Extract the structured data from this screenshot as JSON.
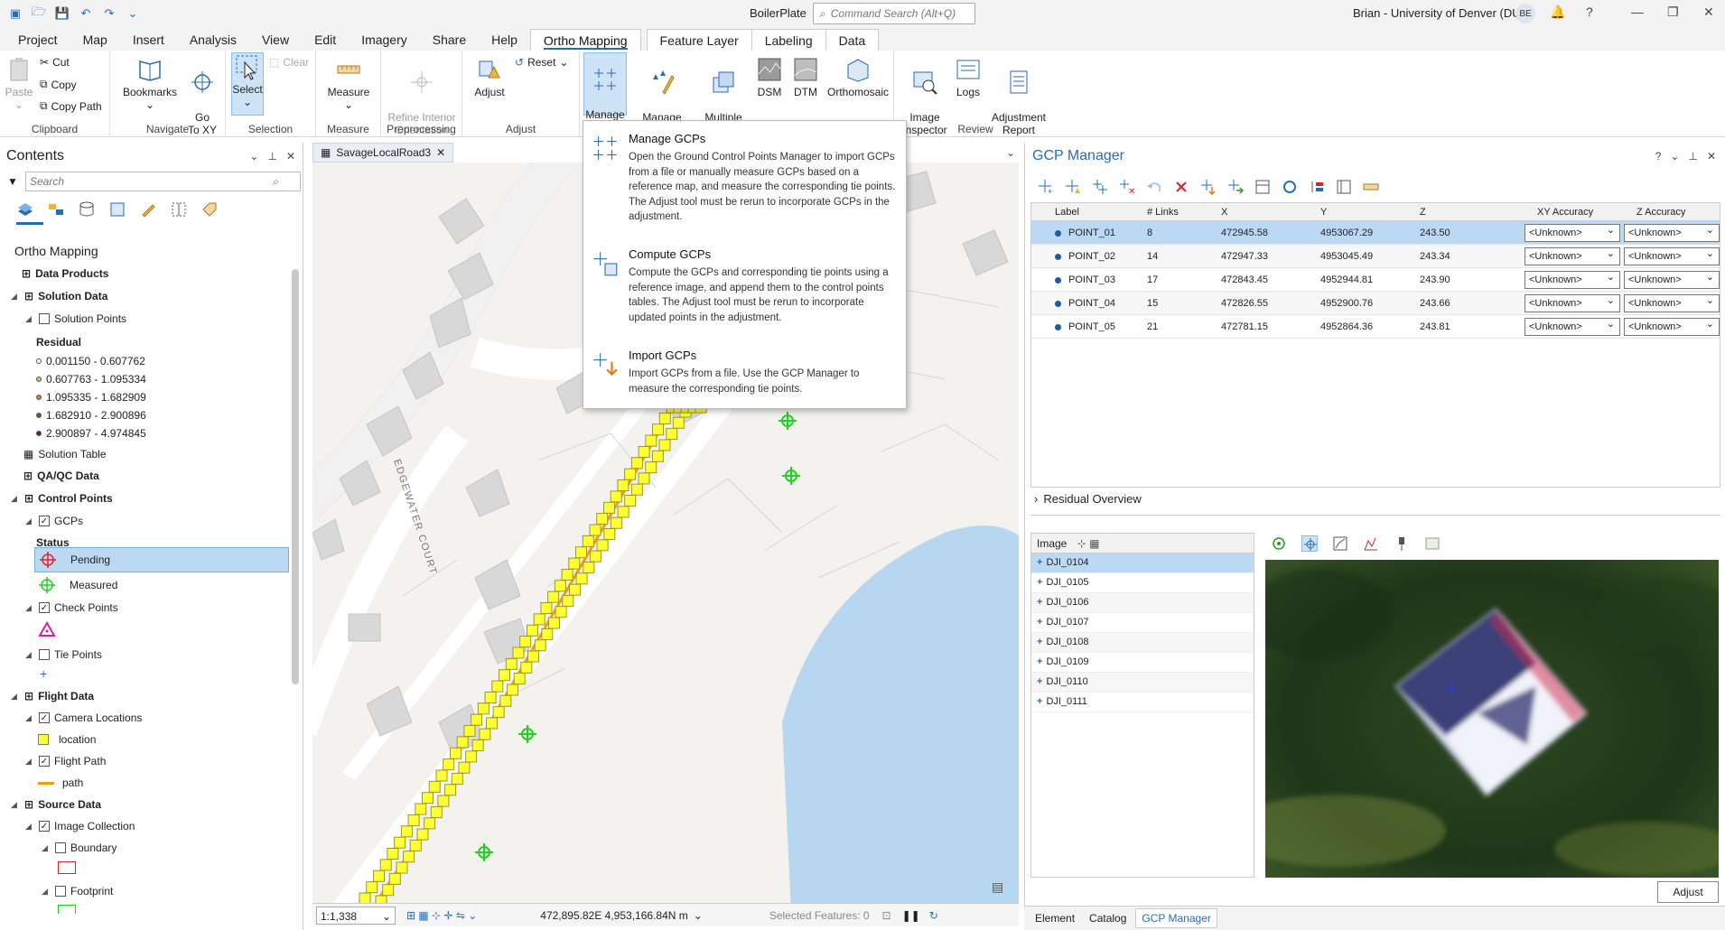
{
  "titlebar": {
    "project_name": "BoilerPlate",
    "command_search_placeholder": "Command Search (Alt+Q)",
    "user": "Brian - University of Denver (DU)",
    "avatar_initials": "BE"
  },
  "ribbon_tabs": [
    "Project",
    "Map",
    "Insert",
    "Analysis",
    "View",
    "Edit",
    "Imagery",
    "Share",
    "Help",
    "Ortho Mapping",
    "Feature Layer",
    "Labeling",
    "Data"
  ],
  "ribbon": {
    "clipboard": {
      "paste": "Paste",
      "cut": "Cut",
      "copy": "Copy",
      "copy_path": "Copy Path",
      "label": "Clipboard"
    },
    "navigate": {
      "bookmarks": "Bookmarks",
      "goto": "Go\nTo XY",
      "label": "Navigate"
    },
    "selection": {
      "select": "Select",
      "clear": "Clear",
      "label": "Selection"
    },
    "measure": {
      "measure": "Measure",
      "label": "Measure"
    },
    "preprocessing": {
      "refine": "Refine Interior\nOrientation",
      "label": "Preprocessing"
    },
    "adjust": {
      "adjust": "Adjust",
      "reset": "Reset",
      "label": "Adjust"
    },
    "gcps": {
      "manage_gcps": "Manage\nGCPs",
      "manage_tie": "Manage\nTie Points"
    },
    "products": {
      "multiple": "Multiple\nProducts",
      "dsm": "DSM",
      "dtm": "DTM",
      "ortho": "Orthomosaic"
    },
    "review": {
      "inspector": "Image\nInspector",
      "logs": "Logs",
      "report": "Adjustment\nReport",
      "label": "Review"
    }
  },
  "dropdown": [
    {
      "title": "Manage GCPs",
      "desc": "Open the Ground Control Points Manager to import GCPs from a file or manually measure GCPs based on a reference map, and measure the corresponding tie points.  The Adjust tool must be rerun to incorporate GCPs in the adjustment."
    },
    {
      "title": "Compute GCPs",
      "desc": "Compute the GCPs and corresponding tie points using a reference image, and append them to the control points tables. The Adjust tool must be rerun to incorporate updated points in the adjustment."
    },
    {
      "title": "Import GCPs",
      "desc": "Import GCPs from a file. Use the GCP Manager to measure the corresponding tie points."
    }
  ],
  "contents": {
    "title": "Contents",
    "search_placeholder": "Search",
    "group_title": "Ortho Mapping",
    "data_products": "Data Products",
    "solution_data": "Solution Data",
    "solution_points": "Solution Points",
    "residual": "Residual",
    "residual_classes": [
      "0.001150 - 0.607762",
      "0.607763 - 1.095334",
      "1.095335 - 1.682909",
      "1.682910 - 2.900896",
      "2.900897 - 4.974845"
    ],
    "solution_table": "Solution Table",
    "qaqc": "QA/QC Data",
    "control_points": "Control Points",
    "gcps": "GCPs",
    "status": "Status",
    "pending": "Pending",
    "measured": "Measured",
    "check_points": "Check Points",
    "tie_points": "Tie Points",
    "flight_data": "Flight Data",
    "camera_locations": "Camera Locations",
    "location": "location",
    "flight_path": "Flight Path",
    "path": "path",
    "source_data": "Source Data",
    "image_collection": "Image Collection",
    "boundary": "Boundary",
    "footprint": "Footprint"
  },
  "map": {
    "tab": "SavageLocalRoad3",
    "street_label": "EDGEWATER COURT",
    "scale": "1:1,338",
    "coords": "472,895.82E 4,953,166.84N m",
    "selected": "Selected Features: 0"
  },
  "gcp": {
    "title": "GCP Manager",
    "columns": [
      "Label",
      "# Links",
      "X",
      "Y",
      "Z",
      "XY Accuracy",
      "Z Accuracy"
    ],
    "rows": [
      {
        "label": "POINT_01",
        "links": "8",
        "x": "472945.58",
        "y": "4953067.29",
        "z": "243.50",
        "xy": "<Unknown>",
        "za": "<Unknown>"
      },
      {
        "label": "POINT_02",
        "links": "14",
        "x": "472947.33",
        "y": "4953045.49",
        "z": "243.34",
        "xy": "<Unknown>",
        "za": "<Unknown>"
      },
      {
        "label": "POINT_03",
        "links": "17",
        "x": "472843.45",
        "y": "4952944.81",
        "z": "243.90",
        "xy": "<Unknown>",
        "za": "<Unknown>"
      },
      {
        "label": "POINT_04",
        "links": "15",
        "x": "472826.55",
        "y": "4952900.76",
        "z": "243.66",
        "xy": "<Unknown>",
        "za": "<Unknown>"
      },
      {
        "label": "POINT_05",
        "links": "21",
        "x": "472781.15",
        "y": "4952864.36",
        "z": "243.81",
        "xy": "<Unknown>",
        "za": "<Unknown>"
      }
    ],
    "residual_overview": "Residual Overview",
    "image_header": "Image",
    "images": [
      "DJI_0104",
      "DJI_0105",
      "DJI_0106",
      "DJI_0107",
      "DJI_0108",
      "DJI_0109",
      "DJI_0110",
      "DJI_0111"
    ],
    "adjust": "Adjust"
  },
  "bottom_tabs": [
    "Element",
    "Catalog",
    "GCP Manager"
  ]
}
